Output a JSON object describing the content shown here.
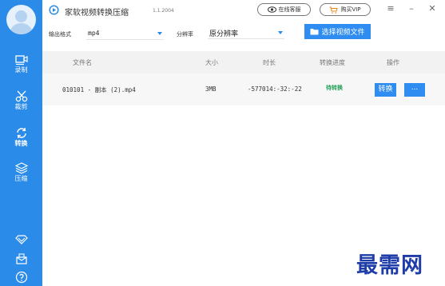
{
  "app": {
    "title": "家软视频转换压缩",
    "version": "1.1.2004"
  },
  "header": {
    "service_label": "在线客服",
    "vip_label": "购买VIP",
    "menu_icon": "hamburger-icon",
    "minimize_icon": "minimize-icon",
    "close_icon": "close-icon"
  },
  "sidebar": {
    "items": [
      {
        "label": "录制",
        "icon": "record-icon"
      },
      {
        "label": "裁剪",
        "icon": "scissors-icon"
      },
      {
        "label": "转换",
        "icon": "convert-icon",
        "active": true
      },
      {
        "label": "压缩",
        "icon": "compress-icon"
      }
    ],
    "bottom_icons": [
      "vip-diamond-icon",
      "feedback-icon",
      "help-icon"
    ]
  },
  "toolbar": {
    "format_label": "输出格式",
    "format_value": "mp4",
    "resolution_label": "分辨率",
    "resolution_value": "原分辨率",
    "choose_button": "选择视频文件"
  },
  "table": {
    "headers": [
      "文件名",
      "大小",
      "时长",
      "转换进度",
      "操作"
    ],
    "rows": [
      {
        "filename": "010101 - 副本 (2).mp4",
        "size": "3MB",
        "duration": "-577014:-32:-22",
        "status": "待转换",
        "action": "转换",
        "more": "..."
      }
    ]
  },
  "watermark": "最需网",
  "colors": {
    "sidebar": "#2b8be8",
    "accent": "#2f8cf0",
    "status_green": "#1e9e55",
    "watermark": "#1f3da8"
  }
}
